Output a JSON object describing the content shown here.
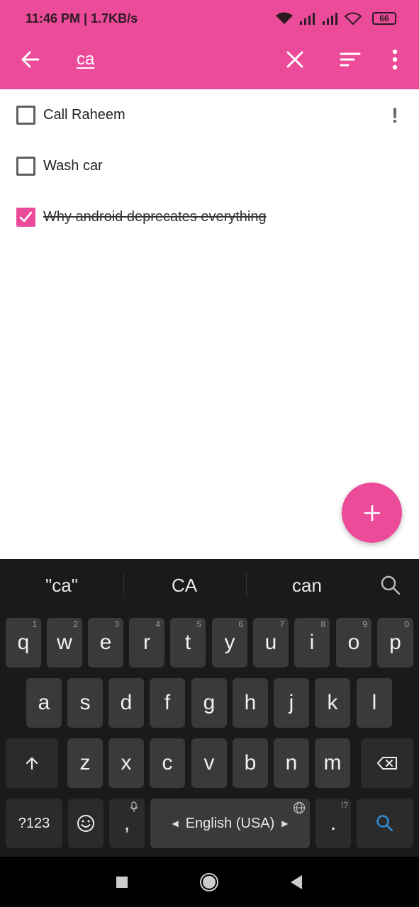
{
  "status_bar": {
    "time_speed": "11:46 PM | 1.7KB/s",
    "battery": "66"
  },
  "app_bar": {
    "search_query": "ca",
    "icons": [
      "back-arrow-icon",
      "close-icon",
      "sort-icon",
      "more-vert-icon"
    ]
  },
  "tasks": [
    {
      "label": "Call Raheem",
      "checked": false,
      "priority_mark": "!"
    },
    {
      "label": "Wash car",
      "checked": false,
      "priority_mark": ""
    },
    {
      "label": "Why android deprecates everything",
      "checked": true,
      "priority_mark": ""
    }
  ],
  "fab": {
    "symbol": "+"
  },
  "keyboard": {
    "suggestions": [
      "\"ca\"",
      "CA",
      "can"
    ],
    "row1": [
      {
        "k": "q",
        "h": "1"
      },
      {
        "k": "w",
        "h": "2"
      },
      {
        "k": "e",
        "h": "3"
      },
      {
        "k": "r",
        "h": "4"
      },
      {
        "k": "t",
        "h": "5"
      },
      {
        "k": "y",
        "h": "6"
      },
      {
        "k": "u",
        "h": "7"
      },
      {
        "k": "i",
        "h": "8"
      },
      {
        "k": "o",
        "h": "9"
      },
      {
        "k": "p",
        "h": "0"
      }
    ],
    "row2": [
      "a",
      "s",
      "d",
      "f",
      "g",
      "h",
      "j",
      "k",
      "l"
    ],
    "row3": [
      "z",
      "x",
      "c",
      "v",
      "b",
      "n",
      "m"
    ],
    "numbers_key": "?123",
    "comma": ",",
    "space_label": "English (USA)",
    "period": ".",
    "period_hint": "!?",
    "accent_color": "#2f8fd8"
  },
  "colors": {
    "brand": "#ec4b99",
    "keyboard_bg": "#1a1a1a"
  }
}
